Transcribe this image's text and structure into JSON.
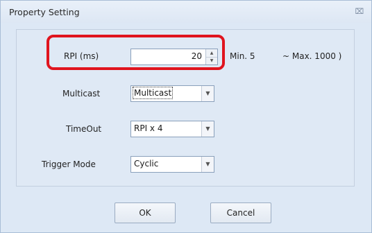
{
  "dialog": {
    "title": "Property Setting",
    "close_glyph": "⌦"
  },
  "fields": {
    "rpi": {
      "label": "RPI (ms)",
      "value": "20",
      "min_text": "Min. 5",
      "max_text": "~ Max. 1000   )"
    },
    "multicast": {
      "label": "Multicast",
      "value": "Multicast"
    },
    "timeout": {
      "label": "TimeOut",
      "value": "RPI x 4"
    },
    "trigger_mode": {
      "label": "Trigger Mode",
      "value": "Cyclic"
    }
  },
  "buttons": {
    "ok": "OK",
    "cancel": "Cancel"
  },
  "icons": {
    "spin_up": "up-arrow-icon",
    "spin_down": "down-arrow-icon",
    "combo_arrow": "chevron-down-icon",
    "close": "close-icon"
  },
  "colors": {
    "highlight": "#e0141e",
    "dialog_bg": "#dde8f5"
  }
}
